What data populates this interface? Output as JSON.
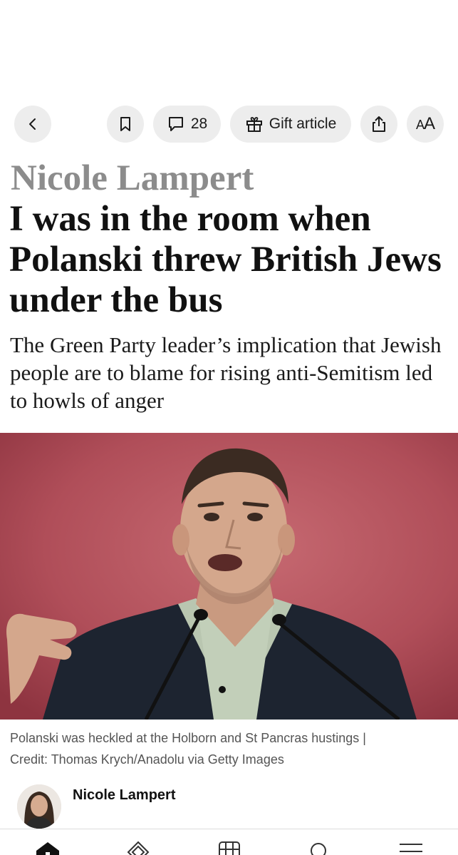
{
  "toolbar": {
    "back_icon": "chevron-left-icon",
    "bookmark_icon": "bookmark-icon",
    "comments_icon": "comment-bubble-icon",
    "comment_count": "28",
    "gift_icon": "gift-icon",
    "gift_label": "Gift article",
    "share_icon": "share-icon",
    "font_size_label_small": "A",
    "font_size_label_big": "A"
  },
  "article": {
    "kicker": "Nicole Lampert",
    "headline": "I was in the room when Polanski threw British Jews under the bus",
    "standfirst": "The Green Party leader’s implication that Jewish people are to blame for rising anti-Semitism led to howls of anger",
    "image_caption": "Polanski was heckled at the Holborn and St Pancras hustings",
    "image_caption_separator": "|",
    "image_credit": "Credit: Thomas Krych/Anadolu via Getty Images",
    "author_name": "Nicole Lampert"
  },
  "bottom_nav": {
    "items": [
      {
        "icon": "home-icon",
        "active": true
      },
      {
        "icon": "puzzles-icon",
        "active": false
      },
      {
        "icon": "sections-grid-icon",
        "active": false
      },
      {
        "icon": "search-icon",
        "active": false
      },
      {
        "icon": "menu-icon",
        "active": false
      }
    ]
  },
  "colors": {
    "pill_background": "#ededed",
    "kicker": "#8c8c8c",
    "headline": "#111111",
    "caption": "#555555",
    "hero_background": "#b4505a"
  }
}
